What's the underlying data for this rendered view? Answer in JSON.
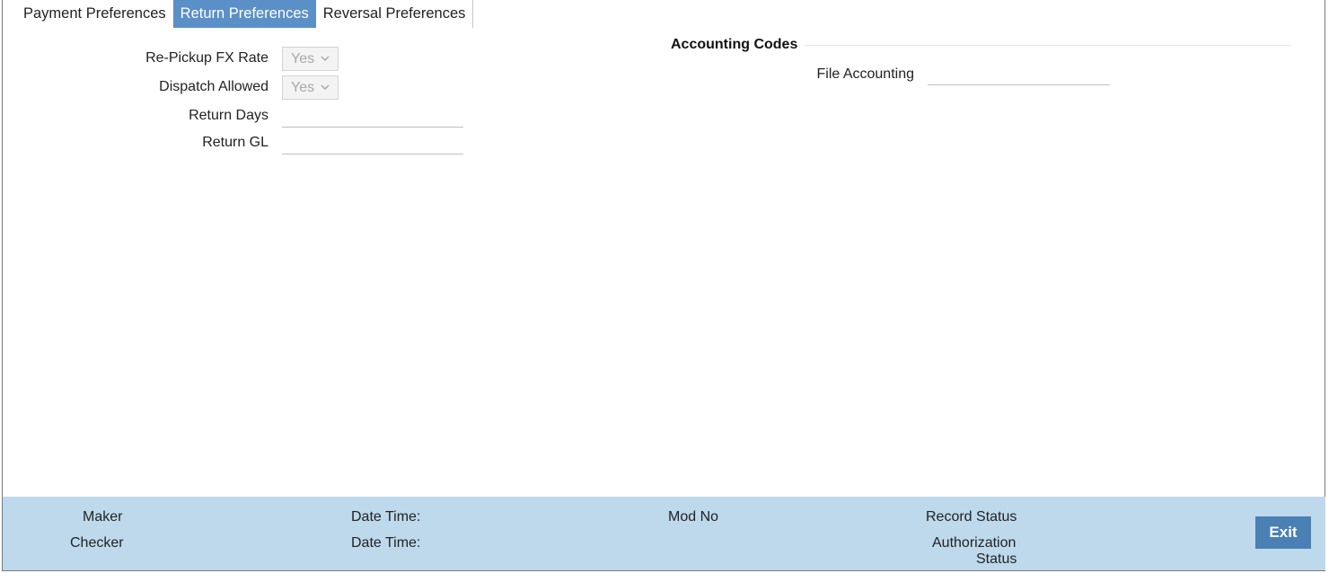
{
  "tabs": [
    {
      "label": "Payment Preferences",
      "active": false
    },
    {
      "label": "Return Preferences",
      "active": true
    },
    {
      "label": "Reversal Preferences",
      "active": false
    }
  ],
  "form": {
    "repickup_fx_rate": {
      "label": "Re-Pickup FX Rate",
      "value": "Yes"
    },
    "dispatch_allowed": {
      "label": "Dispatch Allowed",
      "value": "Yes"
    },
    "return_days": {
      "label": "Return Days",
      "value": ""
    },
    "return_gl": {
      "label": "Return GL",
      "value": ""
    }
  },
  "accounting": {
    "title": "Accounting Codes",
    "file_accounting": {
      "label": "File Accounting",
      "value": ""
    }
  },
  "footer": {
    "maker": "Maker",
    "checker": "Checker",
    "date_time_1": "Date Time:",
    "date_time_2": "Date Time:",
    "mod_no": "Mod No",
    "record_status": "Record Status",
    "authorization_line1": "Authorization",
    "authorization_line2": "Status",
    "exit_label": "Exit"
  },
  "colors": {
    "active_tab": "#5b8fc7",
    "footer_bg": "#bed9ec",
    "exit_button": "#4a80b3"
  }
}
